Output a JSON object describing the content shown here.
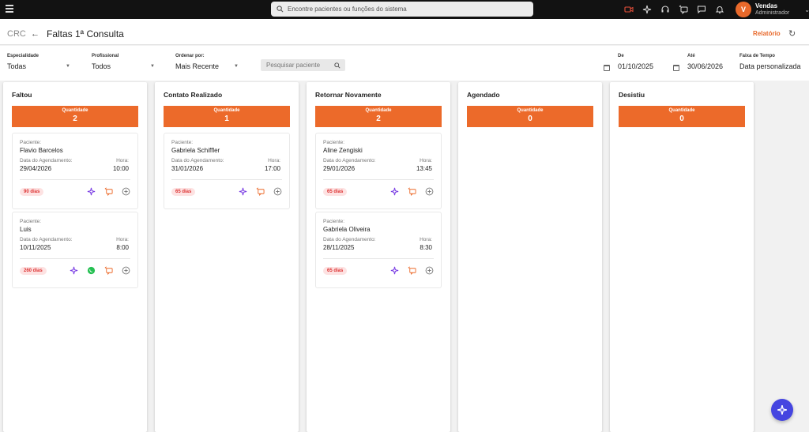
{
  "topbar": {
    "search_placeholder": "Encontre pacientes ou funções do sistema",
    "icons": [
      "video-icon",
      "sparkle-icon",
      "headset-icon",
      "chat-swap-icon",
      "message-icon",
      "bell-icon"
    ],
    "user": {
      "initial": "V",
      "name": "Vendas",
      "role": "Administrador"
    }
  },
  "header": {
    "breadcrumb": "CRC",
    "title": "Faltas 1ª Consulta",
    "report_label": "Relatório"
  },
  "filters": {
    "especialidade": {
      "label": "Especialidade",
      "value": "Todas"
    },
    "profissional": {
      "label": "Profissional",
      "value": "Todos"
    },
    "ordenar": {
      "label": "Ordenar por:",
      "value": "Mais Recente"
    },
    "search_placeholder": "Pesquisar paciente",
    "de": {
      "label": "De",
      "value": "01/10/2025"
    },
    "ate": {
      "label": "Até",
      "value": "30/06/2026"
    },
    "faixa": {
      "label": "Faixa de Tempo",
      "value": "Data personalizada"
    }
  },
  "labels": {
    "quantidade": "Quantidade",
    "paciente": "Paciente:",
    "data_agendamento": "Data do Agendamento:",
    "hora": "Hora:"
  },
  "columns": [
    {
      "title": "Faltou",
      "count": "2",
      "cards": [
        {
          "patient": "Flavio Barcelos",
          "date": "29/04/2026",
          "time": "10:00",
          "days": "90 dias",
          "whatsapp": false
        },
        {
          "patient": "Luis",
          "date": "10/11/2025",
          "time": "8:00",
          "days": "260 dias",
          "whatsapp": true
        }
      ]
    },
    {
      "title": "Contato Realizado",
      "count": "1",
      "cards": [
        {
          "patient": "Gabriela Schiffler",
          "date": "31/01/2026",
          "time": "17:00",
          "days": "65 dias",
          "whatsapp": false
        }
      ]
    },
    {
      "title": "Retornar Novamente",
      "count": "2",
      "cards": [
        {
          "patient": "Aline Zengiski",
          "date": "29/01/2026",
          "time": "13:45",
          "days": "65 dias",
          "whatsapp": false
        },
        {
          "patient": "Gabriela Oliveira",
          "date": "28/11/2025",
          "time": "8:30",
          "days": "65 dias",
          "whatsapp": false
        }
      ]
    },
    {
      "title": "Agendado",
      "count": "0",
      "cards": []
    },
    {
      "title": "Desistiu",
      "count": "0",
      "cards": []
    }
  ],
  "colors": {
    "accent": "#ec6a2a",
    "topbar": "#121212",
    "fab": "#4545e0",
    "sparkle": "#7b3fe4",
    "whatsapp": "#25c052"
  }
}
